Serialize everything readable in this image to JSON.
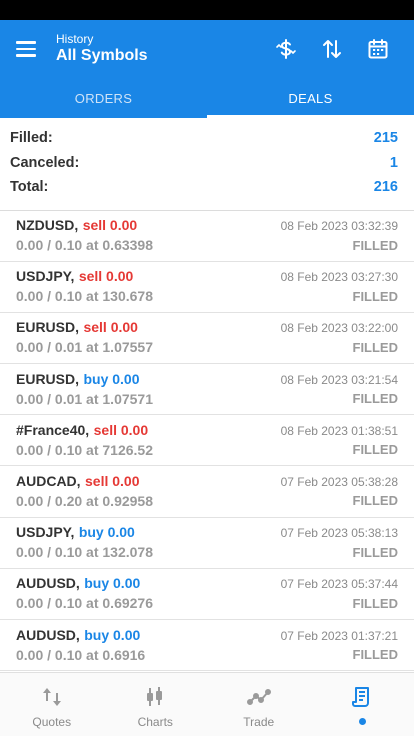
{
  "header": {
    "subtitle": "History",
    "title": "All Symbols",
    "icons": [
      "menu-icon",
      "currency-exchange-icon",
      "sort-icon",
      "calendar-icon"
    ]
  },
  "tabs": [
    {
      "label": "ORDERS",
      "active": false
    },
    {
      "label": "DEALS",
      "active": true
    }
  ],
  "summary": {
    "filled_label": "Filled:",
    "filled_value": "215",
    "canceled_label": "Canceled:",
    "canceled_value": "1",
    "total_label": "Total:",
    "total_value": "216"
  },
  "deals": [
    {
      "symbol": "NZDUSD,",
      "side": "sell 0.00",
      "side_type": "sell",
      "time": "08 Feb 2023 03:32:39",
      "volume": "0.00 / 0.10 at 0.63398",
      "status": "FILLED"
    },
    {
      "symbol": "USDJPY,",
      "side": "sell 0.00",
      "side_type": "sell",
      "time": "08 Feb 2023 03:27:30",
      "volume": "0.00 / 0.10 at 130.678",
      "status": "FILLED"
    },
    {
      "symbol": "EURUSD,",
      "side": "sell 0.00",
      "side_type": "sell",
      "time": "08 Feb 2023 03:22:00",
      "volume": "0.00 / 0.01 at 1.07557",
      "status": "FILLED"
    },
    {
      "symbol": "EURUSD,",
      "side": "buy 0.00",
      "side_type": "buy",
      "time": "08 Feb 2023 03:21:54",
      "volume": "0.00 / 0.01 at 1.07571",
      "status": "FILLED"
    },
    {
      "symbol": "#France40,",
      "side": "sell 0.00",
      "side_type": "sell",
      "time": "08 Feb 2023 01:38:51",
      "volume": "0.00 / 0.10 at 7126.52",
      "status": "FILLED"
    },
    {
      "symbol": "AUDCAD,",
      "side": "sell 0.00",
      "side_type": "sell",
      "time": "07 Feb 2023 05:38:28",
      "volume": "0.00 / 0.20 at 0.92958",
      "status": "FILLED"
    },
    {
      "symbol": "USDJPY,",
      "side": "buy 0.00",
      "side_type": "buy",
      "time": "07 Feb 2023 05:38:13",
      "volume": "0.00 / 0.10 at 132.078",
      "status": "FILLED"
    },
    {
      "symbol": "AUDUSD,",
      "side": "buy 0.00",
      "side_type": "buy",
      "time": "07 Feb 2023 05:37:44",
      "volume": "0.00 / 0.10 at 0.69276",
      "status": "FILLED"
    },
    {
      "symbol": "AUDUSD,",
      "side": "buy 0.00",
      "side_type": "buy",
      "time": "07 Feb 2023 01:37:21",
      "volume": "0.00 / 0.10 at 0.6916",
      "status": "FILLED"
    }
  ],
  "bottom_nav": [
    {
      "label": "Quotes",
      "icon": "quotes-icon",
      "active": false
    },
    {
      "label": "Charts",
      "icon": "charts-icon",
      "active": false
    },
    {
      "label": "Trade",
      "icon": "trade-icon",
      "active": false
    },
    {
      "label": "",
      "icon": "history-icon",
      "active": true
    }
  ],
  "colors": {
    "accent": "#1a86e6",
    "sell": "#e53935",
    "buy": "#1a86e6",
    "muted": "#9a9a9a"
  }
}
